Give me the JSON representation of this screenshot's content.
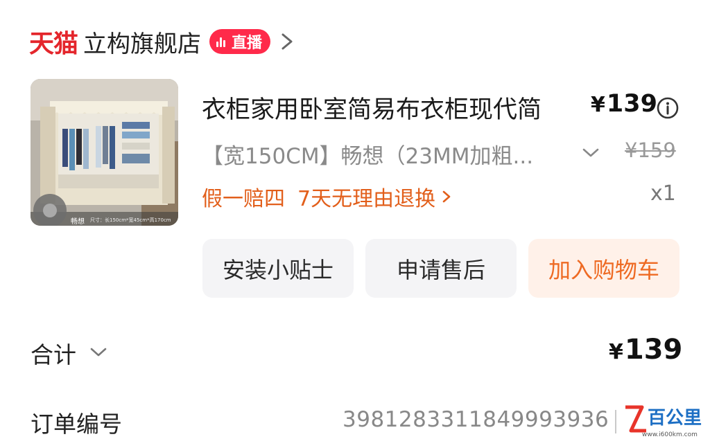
{
  "header": {
    "brand": "天猫",
    "store_name": "立构旗舰店",
    "live_badge": "直播"
  },
  "product": {
    "title": "衣柜家用卧室简易布衣柜现代简",
    "price_symbol": "¥",
    "price": "139",
    "variant": "【宽150CM】畅想（23MM加粗...",
    "original_price": "¥159",
    "services": [
      "假一赔四",
      "7天无理由退换"
    ],
    "quantity": "x1",
    "image_caption_brand": "畅想",
    "image_caption_size": "尺寸：长150cm*宽45cm*高170cm"
  },
  "actions": {
    "tips": "安装小贴士",
    "after_sales": "申请售后",
    "add_to_cart": "加入购物车"
  },
  "summary": {
    "total_label": "合计",
    "total_symbol": "¥",
    "total_value": "139"
  },
  "order": {
    "number_label": "订单编号",
    "number": "3981283311849993936"
  },
  "watermark": {
    "text": "百公里",
    "url": "www.i600km.com"
  },
  "colors": {
    "brand_red": "#e4262c",
    "live_red": "#ff2a4a",
    "service_orange": "#e25f1b",
    "cart_orange": "#ee6a23"
  },
  "icons": [
    "live-bars-icon",
    "chevron-right-icon",
    "info-icon",
    "chevron-down-icon"
  ]
}
